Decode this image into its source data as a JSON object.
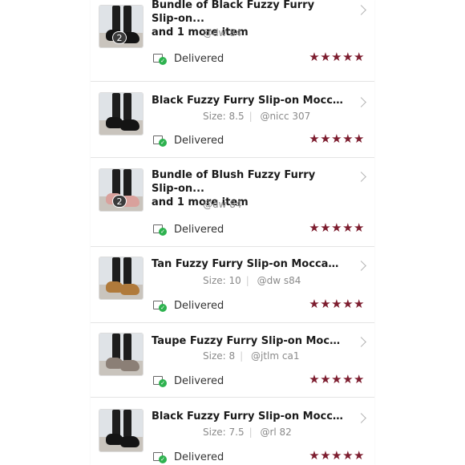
{
  "colors": {
    "star": "#7d1d2f",
    "delivered_check": "#2eb24f"
  },
  "orders": [
    {
      "title_line1": "Bundle of Black Fuzzy Furry Slip-on...",
      "title_line2": "and 1 more item",
      "size": "",
      "handle": "@dw    84",
      "badge": "2",
      "status": "Delivered",
      "rating": 5,
      "stars": "★★★★★",
      "shoe_color": "#141414"
    },
    {
      "title_line1": "Black Fuzzy Furry Slip-on Moccasin...",
      "title_line2": "",
      "size": "Size: 8.5",
      "handle": "@nicc     307",
      "badge": "",
      "status": "Delivered",
      "rating": 5,
      "stars": "★★★★★",
      "shoe_color": "#141414"
    },
    {
      "title_line1": "Bundle of Blush Fuzzy Furry Slip-on...",
      "title_line2": "and 1 more item",
      "size": "",
      "handle": "@dw    84",
      "badge": "2",
      "status": "Delivered",
      "rating": 5,
      "stars": "★★★★★",
      "shoe_color": "#d9a19c"
    },
    {
      "title_line1": "Tan Fuzzy Furry Slip-on Moccasin Sli...",
      "title_line2": "",
      "size": "Size: 10",
      "handle": "@dw    s84",
      "badge": "",
      "status": "Delivered",
      "rating": 5,
      "stars": "★★★★★",
      "shoe_color": "#b07a3b"
    },
    {
      "title_line1": "Taupe Fuzzy Furry Slip-on Moccasin...",
      "title_line2": "",
      "size": "Size: 8",
      "handle": "@jtlm    ca1",
      "badge": "",
      "status": "Delivered",
      "rating": 5,
      "stars": "★★★★★",
      "shoe_color": "#8b7f76"
    },
    {
      "title_line1": "Black Fuzzy Furry Slip-on Moccasin...",
      "title_line2": "",
      "size": "Size: 7.5",
      "handle": "@rl    82",
      "badge": "",
      "status": "Delivered",
      "rating": 5,
      "stars": "★★★★★",
      "shoe_color": "#141414"
    }
  ]
}
